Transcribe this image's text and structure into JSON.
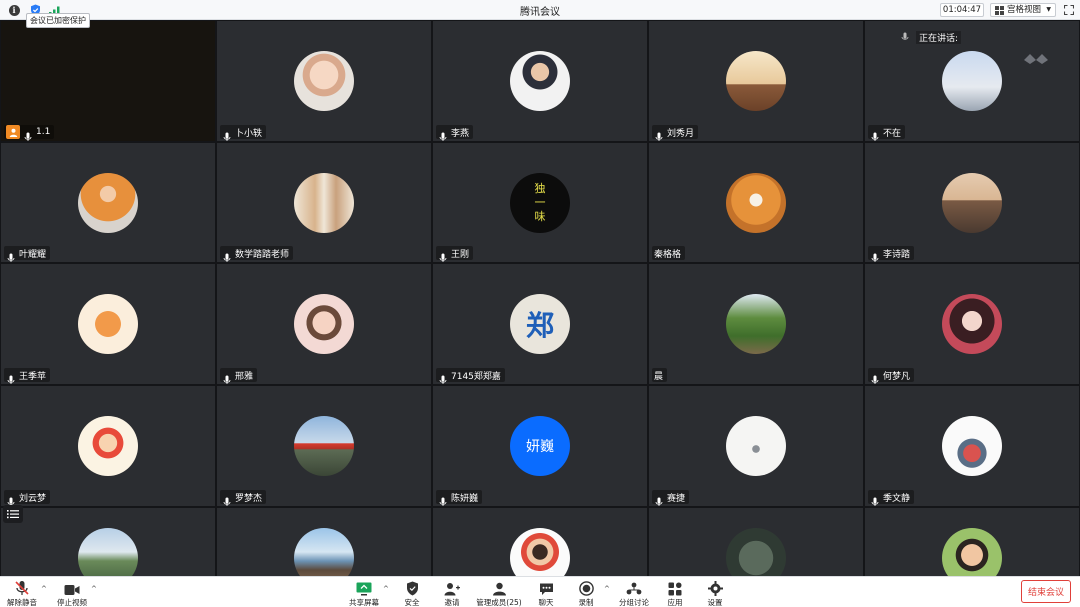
{
  "window": {
    "title": "腾讯会议"
  },
  "topbar": {
    "tooltip": "会议已加密保护",
    "timer": "01:04:47",
    "view_label": "宫格视图"
  },
  "speaking": {
    "label": "正在讲话:"
  },
  "participants": [
    {
      "name": "1.1",
      "host": true
    },
    {
      "name": "卜小轶"
    },
    {
      "name": "李燕"
    },
    {
      "name": "刘秀月"
    },
    {
      "name": "不在"
    },
    {
      "name": "叶耀耀"
    },
    {
      "name": "数学踏踏老师"
    },
    {
      "name": "王刚"
    },
    {
      "name": "秦格格"
    },
    {
      "name": "李诗踏"
    },
    {
      "name": "王季苹"
    },
    {
      "name": "邢雅"
    },
    {
      "name": "7145郑郑嘉"
    },
    {
      "name": "晨"
    },
    {
      "name": "何梦凡"
    },
    {
      "name": "刘云梦"
    },
    {
      "name": "罗梦杰"
    },
    {
      "name": "陈妍巍",
      "avatar_text": "妍巍"
    },
    {
      "name": "赛捷"
    },
    {
      "name": "季文静"
    },
    {
      "name": ""
    },
    {
      "name": ""
    },
    {
      "name": ""
    },
    {
      "name": ""
    },
    {
      "name": ""
    }
  ],
  "avatar_glyphs": {
    "wang_gang": [
      "独",
      "一",
      "味"
    ],
    "zheng": "郑"
  },
  "toolbar": {
    "unmute": "解除静音",
    "stop_video": "停止视频",
    "share_screen": "共享屏幕",
    "security": "安全",
    "invite": "邀请",
    "manage_members": "管理成员(25)",
    "chat": "聊天",
    "record": "录制",
    "breakout": "分组讨论",
    "apps": "应用",
    "settings": "设置",
    "end_meeting": "结束会议"
  },
  "colors": {
    "accent_blue": "#0a6cff",
    "end_red": "#e0403a",
    "host_orange": "#f08a24",
    "active_green": "#1aa45a"
  }
}
